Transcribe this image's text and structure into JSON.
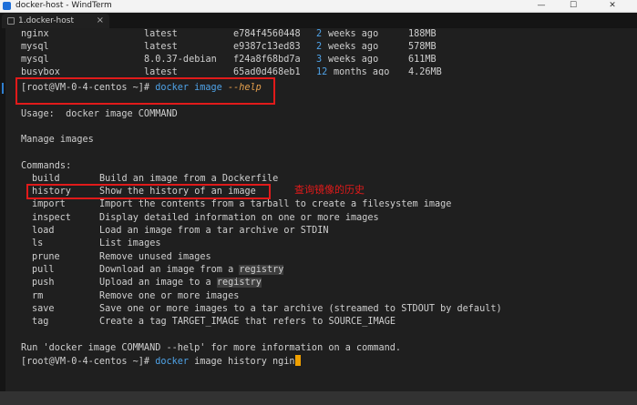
{
  "window": {
    "title": "docker-host - WindTerm",
    "min": "—",
    "max": "☐",
    "close": "✕"
  },
  "tab": {
    "label": "1.docker-host",
    "close": "×"
  },
  "images": [
    {
      "repo": "nginx",
      "tag": "latest",
      "id": "e784f4560448",
      "num": "2",
      "age": "weeks ago",
      "size": "188MB"
    },
    {
      "repo": "mysql",
      "tag": "latest",
      "id": "e9387c13ed83",
      "num": "2",
      "age": "weeks ago",
      "size": "578MB"
    },
    {
      "repo": "mysql",
      "tag": "8.0.37-debian",
      "id": "f24a8f68bd7a",
      "num": "3",
      "age": "weeks ago",
      "size": "611MB"
    },
    {
      "repo": "busybox",
      "tag": "latest",
      "id": "65ad0d468eb1",
      "num": "12",
      "age": "months ago",
      "size": "4.26MB"
    }
  ],
  "prompt1": {
    "prefix": "[root@VM-0-4-centos ~]# ",
    "cmd": "docker image ",
    "flag": "--help"
  },
  "usage": "Usage:  docker image COMMAND",
  "manage": "Manage images",
  "commands_header": "Commands:",
  "commands": [
    {
      "name": "build",
      "desc": "Build an image from a Dockerfile"
    },
    {
      "name": "history",
      "desc": "Show the history of an image"
    },
    {
      "name": "import",
      "desc": "Import the contents from a tarball to create a filesystem image"
    },
    {
      "name": "inspect",
      "desc": "Display detailed information on one or more images"
    },
    {
      "name": "load",
      "desc": "Load an image from a tar archive or STDIN"
    },
    {
      "name": "ls",
      "desc": "List images"
    },
    {
      "name": "prune",
      "desc": "Remove unused images"
    },
    {
      "name": "pull",
      "desc": "Download an image from a ",
      "hl": "registry"
    },
    {
      "name": "push",
      "desc": "Upload an image to a ",
      "hl": "registry"
    },
    {
      "name": "rm",
      "desc": "Remove one or more images"
    },
    {
      "name": "save",
      "desc": "Save one or more images to a tar archive (streamed to STDOUT by default)"
    },
    {
      "name": "tag",
      "desc": "Create a tag TARGET_IMAGE that refers to SOURCE_IMAGE"
    }
  ],
  "footer": "Run 'docker image COMMAND --help' for more information on a command.",
  "prompt2": {
    "prefix": "[root@VM-0-4-centos ~]# ",
    "cmd": "docker",
    "rest": " image history ngin"
  },
  "annotation": "查询镜像的历史",
  "colors": {
    "prompt_blue": "#4fa3e8",
    "flag_orange": "#e5a04d",
    "annotation_red": "#e11a1a",
    "background": "#1f1f1f"
  }
}
